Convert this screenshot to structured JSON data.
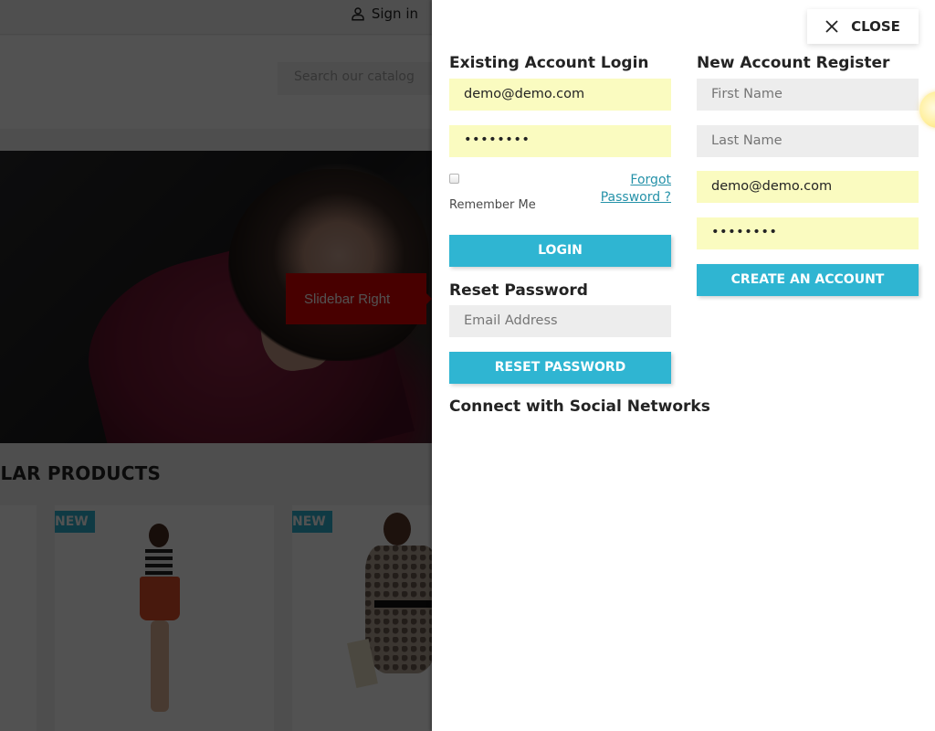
{
  "background_page": {
    "topbar": {
      "signin_icon": "user-icon",
      "signin_label": "Sign in"
    },
    "search": {
      "placeholder": "Search our catalog"
    },
    "hero": {
      "tag_label": "Slidebar Right"
    },
    "section_title": "ULAR PRODUCTS",
    "products": [
      {
        "badge": "NEW"
      },
      {
        "badge": "NEW"
      }
    ]
  },
  "panel": {
    "close": {
      "icon": "close-icon",
      "label": "CLOSE"
    },
    "login": {
      "heading": "Existing Account Login",
      "email_value": "demo@demo.com",
      "password_value": "••••••••",
      "remember_label": "Remember Me",
      "remember_checked": false,
      "forgot_line1": "Forgot",
      "forgot_line2": "Password ?",
      "submit_label": "LOGIN"
    },
    "reset": {
      "heading": "Reset Password",
      "email_placeholder": "Email Address",
      "submit_label": "RESET PASSWORD"
    },
    "social": {
      "heading": "Connect with Social Networks"
    },
    "register": {
      "heading": "New Account Register",
      "first_name_placeholder": "First Name",
      "last_name_placeholder": "Last Name",
      "email_value": "demo@demo.com",
      "password_value": "••••••••",
      "submit_label": "CREATE AN ACCOUNT"
    }
  },
  "colors": {
    "accent": "#2fb5d2",
    "autofill": "#fafbc0",
    "empty_field": "#ededed",
    "tag_red": "#e00000",
    "link": "#2592a9"
  }
}
